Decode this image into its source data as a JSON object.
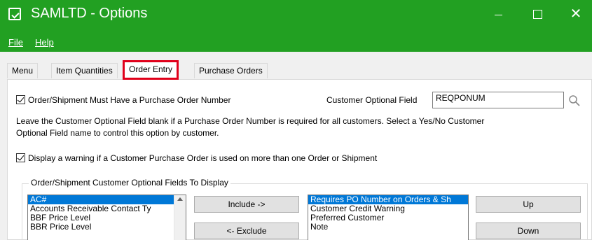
{
  "window": {
    "title": "SAMLTD - Options",
    "icon": "checkmark-app-icon",
    "controls": {
      "minimize": "minimize-icon",
      "maximize": "maximize-icon",
      "close": "✕"
    }
  },
  "menu": [
    {
      "label": "File",
      "underline": "F"
    },
    {
      "label": "Help",
      "underline": "H"
    }
  ],
  "tabs": [
    {
      "label": "Menu"
    },
    {
      "label": "Item Quantities"
    },
    {
      "label": "Order Entry",
      "active": true
    },
    {
      "label": "Purchase Orders"
    }
  ],
  "order_entry": {
    "po_required": {
      "label": "Order/Shipment Must Have a Purchase Order Number",
      "checked": true
    },
    "customer_optional_field": {
      "label": "Customer Optional Field",
      "value": "REQPONUM"
    },
    "help_line1": "Leave the Customer Optional Field blank if a Purchase Order Number is required for all customers. Select a Yes/No Customer",
    "help_line2": "Optional Field name to control this option by customer.",
    "warn_po_reuse": {
      "label": "Display a warning if a Customer Purchase Order is used on more than one Order or Shipment",
      "checked": true
    },
    "fields_group": {
      "title": "Order/Shipment Customer Optional Fields To Display",
      "available": [
        "AC#",
        "Accounts Receivable Contact Ty",
        "BBF Price Level",
        "BBR Price Level"
      ],
      "selected": [
        "Requires PO Number on Orders & Sh",
        "Customer Credit Warning",
        "Preferred Customer",
        "Note"
      ],
      "include_button": "Include ->",
      "exclude_button": "<- Exclude",
      "up_button": "Up",
      "down_button": "Down"
    }
  },
  "colors": {
    "titlebar": "#22a022",
    "highlight": "#e0001a",
    "selection": "#0078d7"
  }
}
